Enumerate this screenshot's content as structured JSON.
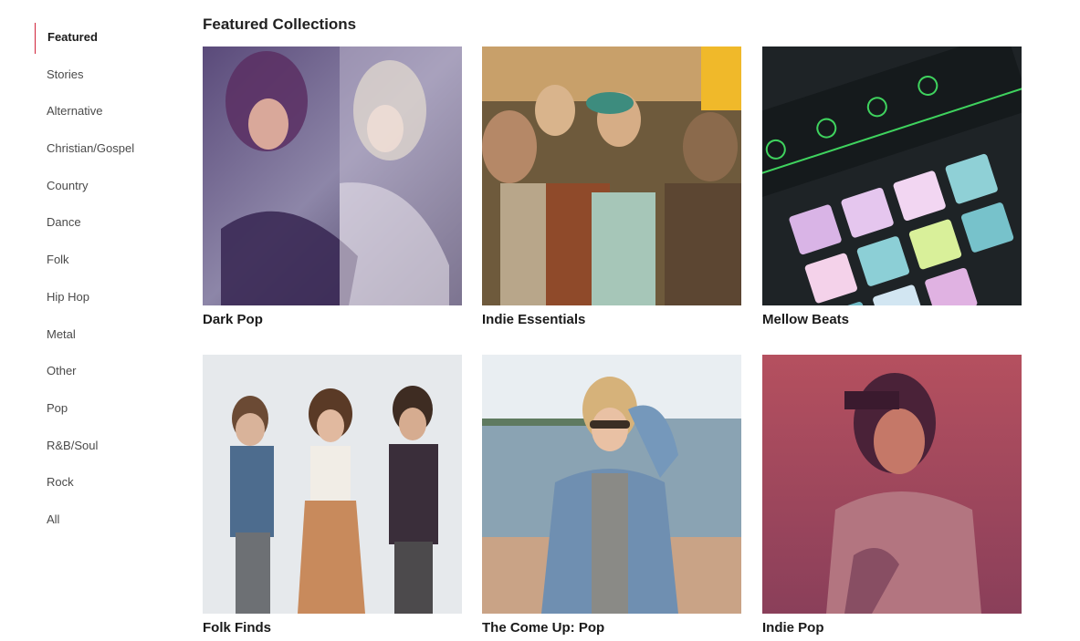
{
  "sidebar": {
    "items": [
      {
        "label": "Featured",
        "active": true
      },
      {
        "label": "Stories"
      },
      {
        "label": "Alternative"
      },
      {
        "label": "Christian/Gospel"
      },
      {
        "label": "Country"
      },
      {
        "label": "Dance"
      },
      {
        "label": "Folk"
      },
      {
        "label": "Hip Hop"
      },
      {
        "label": "Metal"
      },
      {
        "label": "Other"
      },
      {
        "label": "Pop"
      },
      {
        "label": "R&B/Soul"
      },
      {
        "label": "Rock"
      },
      {
        "label": "All"
      }
    ]
  },
  "main": {
    "title": "Featured Collections",
    "collections": [
      {
        "title": "Dark Pop"
      },
      {
        "title": "Indie Essentials"
      },
      {
        "title": "Mellow Beats"
      },
      {
        "title": "Folk Finds"
      },
      {
        "title": "The Come Up: Pop"
      },
      {
        "title": "Indie Pop"
      }
    ]
  },
  "colors": {
    "accent": "#d0243b"
  }
}
